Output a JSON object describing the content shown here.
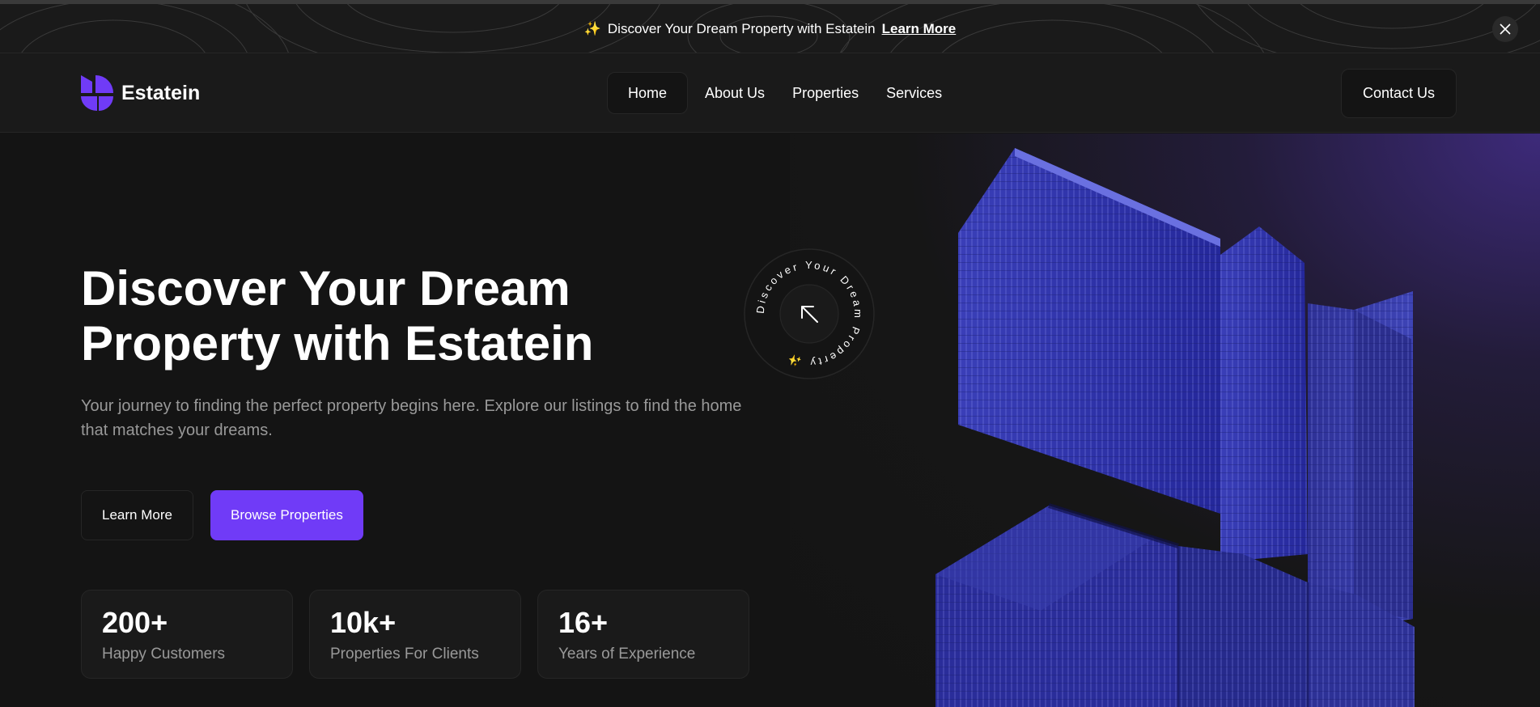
{
  "banner": {
    "text": "Discover Your Dream Property with Estatein",
    "link_label": "Learn More",
    "spark_icon": "sparkles-icon",
    "close_icon": "close-icon"
  },
  "nav": {
    "logo_text": "Estatein",
    "links": [
      {
        "label": "Home",
        "active": true
      },
      {
        "label": "About Us",
        "active": false
      },
      {
        "label": "Properties",
        "active": false
      },
      {
        "label": "Services",
        "active": false
      }
    ],
    "contact_label": "Contact Us"
  },
  "hero": {
    "title_line1": "Discover Your Dream",
    "title_line2": "Property with Estatein",
    "subtitle": "Your journey to finding the perfect property begins here. Explore our listings to find the home that matches your dreams.",
    "learn_more_label": "Learn More",
    "browse_label": "Browse Properties",
    "badge_text": "Discover Your Dream Property ✨",
    "badge_icon": "arrow-up-left-icon",
    "stats": [
      {
        "value": "200+",
        "label": "Happy Customers"
      },
      {
        "value": "10k+",
        "label": "Properties For Clients"
      },
      {
        "value": "16+",
        "label": "Years of Experience"
      }
    ]
  },
  "colors": {
    "accent": "#703bf7",
    "background": "#141414",
    "panel": "#1a1a1a",
    "border": "#262626",
    "muted_text": "#999999"
  }
}
